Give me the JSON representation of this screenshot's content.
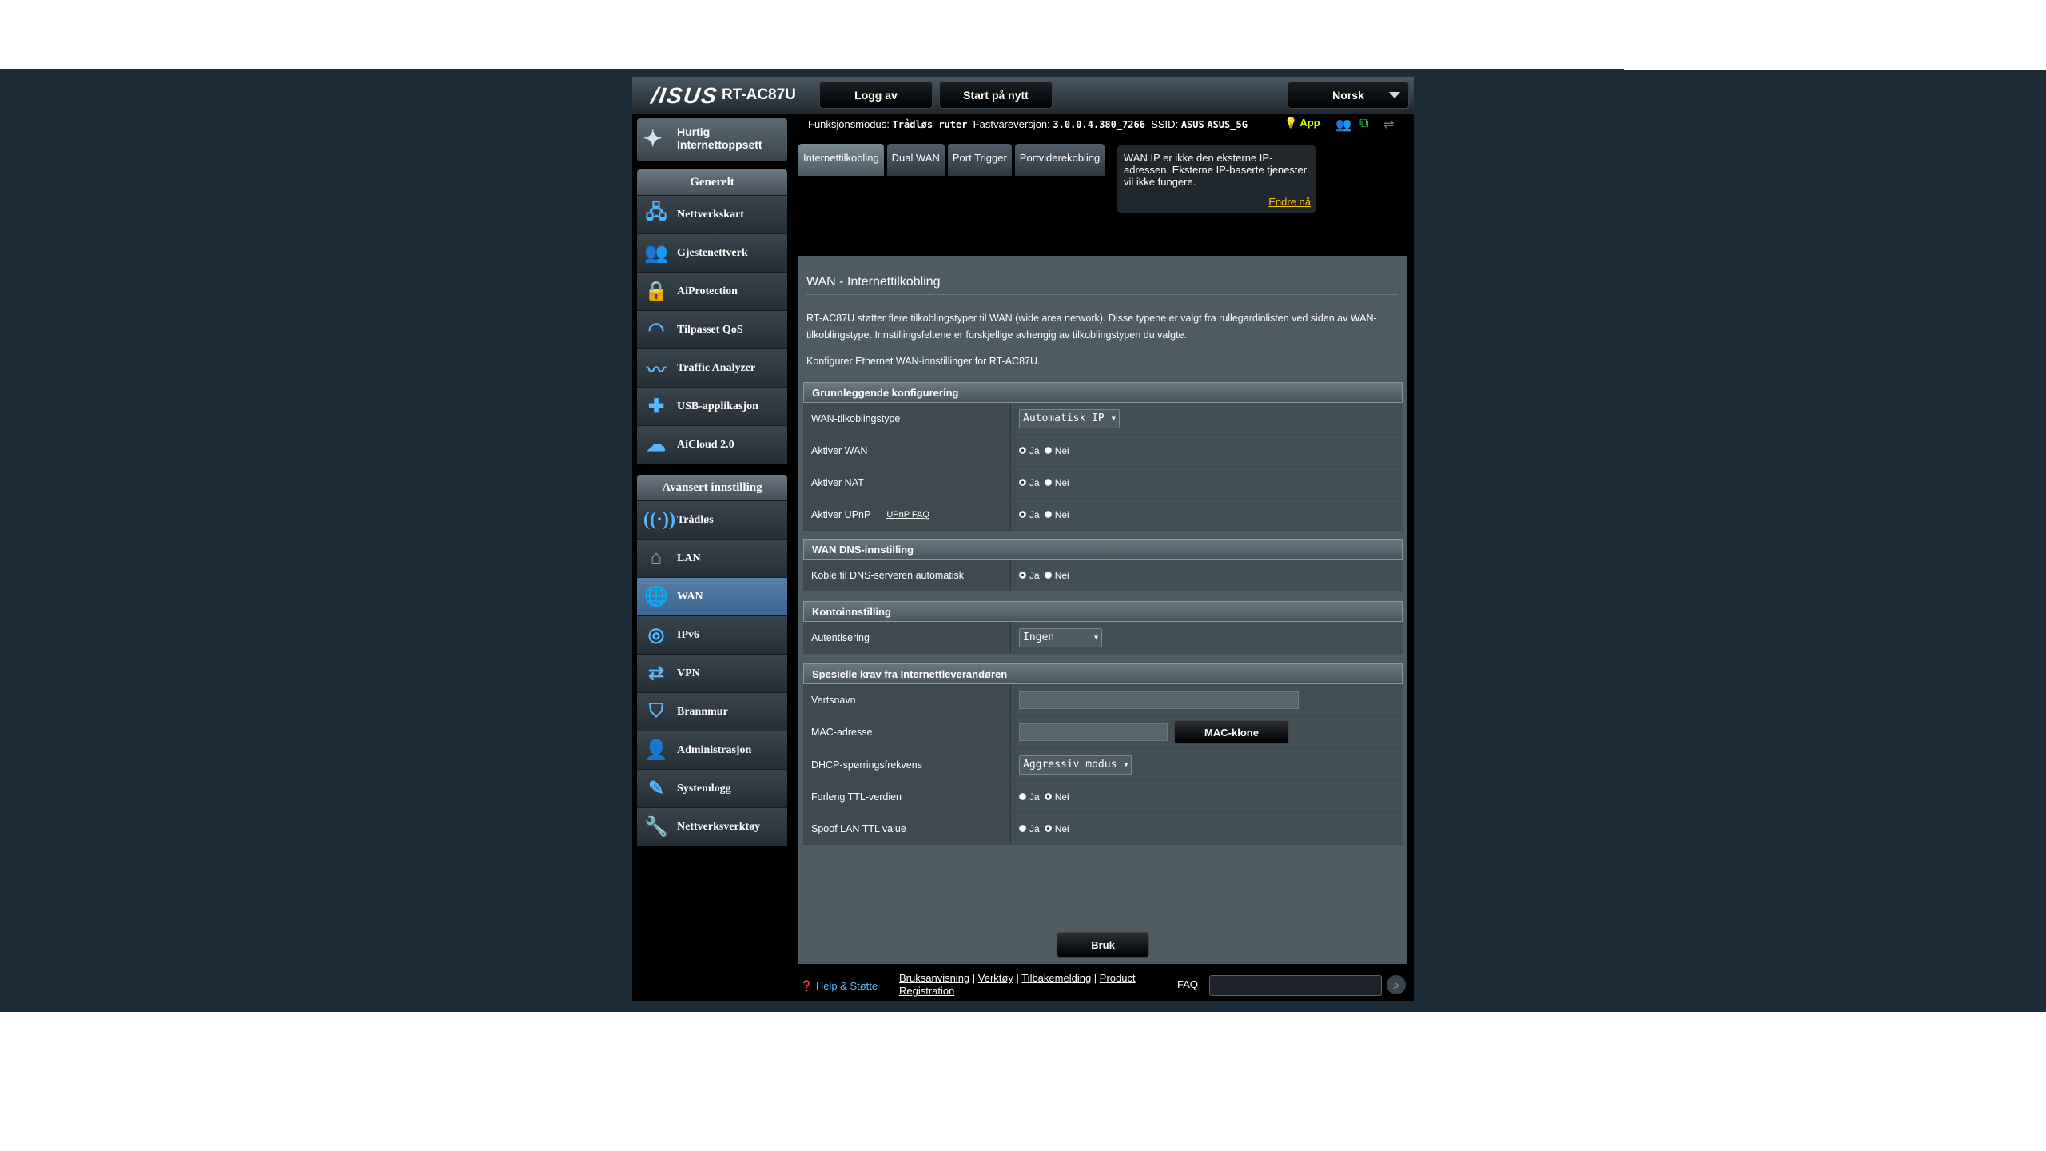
{
  "header": {
    "logo": "/ISUS",
    "model": "RT-AC87U",
    "logout": "Logg av",
    "reboot": "Start på nytt",
    "language": "Norsk"
  },
  "left": {
    "qis": "Hurtig Internettoppsett",
    "general_title": "Generelt",
    "general": [
      "Nettverkskart",
      "Gjestenettverk",
      "AiProtection",
      "Tilpasset QoS",
      "Traffic Analyzer",
      "USB-applikasjon",
      "AiCloud 2.0"
    ],
    "advanced_title": "Avansert innstilling",
    "advanced": [
      "Trådløs",
      "LAN",
      "WAN",
      "IPv6",
      "VPN",
      "Brannmur",
      "Administrasjon",
      "Systemlogg",
      "Nettverksverktøy"
    ]
  },
  "status": {
    "mode_label": "Funksjonsmodus:",
    "mode": "Trådløs ruter",
    "fw_label": "Fastvareversjon:",
    "fw": "3.0.0.4.380_7266",
    "ssid_label": "SSID:",
    "ssid1": "ASUS",
    "ssid2": "ASUS_5G",
    "app": "App"
  },
  "tabs": [
    "Internettilkobling",
    "Dual WAN",
    "Port Trigger",
    "Portviderekobling"
  ],
  "tip": {
    "text": "WAN IP er ikke den eksterne IP-adressen. Eksterne IP-baserte tjenester vil ikke fungere.",
    "link": "Endre nå"
  },
  "main": {
    "title": "WAN - Internettilkobling",
    "desc": "RT-AC87U støtter flere tilkoblingstyper til WAN (wide area network). Disse typene er valgt fra rullegardinlisten ved siden av WAN-tilkoblingstype. Innstillingsfeltene er forskjellige avhengig av tilkoblingstypen du valgte.",
    "configure": "Konfigurer Ethernet WAN-innstillinger for RT-AC87U.",
    "yes": "Ja",
    "no": "Nei",
    "basic": {
      "title": "Grunnleggende konfigurering",
      "conn_type_label": "WAN-tilkoblingstype",
      "conn_type": "Automatisk IP",
      "enable_wan": "Aktiver WAN",
      "enable_nat": "Aktiver NAT",
      "enable_upnp": "Aktiver UPnP",
      "upnp_faq": "UPnP  FAQ"
    },
    "dns": {
      "title": "WAN DNS-innstilling",
      "auto": "Koble til DNS-serveren automatisk"
    },
    "account": {
      "title": "Kontoinnstilling",
      "auth_label": "Autentisering",
      "auth": "Ingen"
    },
    "isp": {
      "title": "Spesielle krav fra Internettleverandøren",
      "host": "Vertsnavn",
      "mac": "MAC-adresse",
      "mac_clone": "MAC-klone",
      "dhcp": "DHCP-spørringsfrekvens",
      "dhcp_val": "Aggressiv modus",
      "ttl": "Forleng TTL-verdien",
      "spoof": "Spoof LAN TTL value"
    },
    "apply": "Bruk"
  },
  "footer": {
    "help": "Help & Støtte",
    "l1": "Bruksanvisning",
    "l2": "Verktøy",
    "l3": "Tilbakemelding",
    "l4": "Product Registration",
    "faq": "FAQ"
  }
}
